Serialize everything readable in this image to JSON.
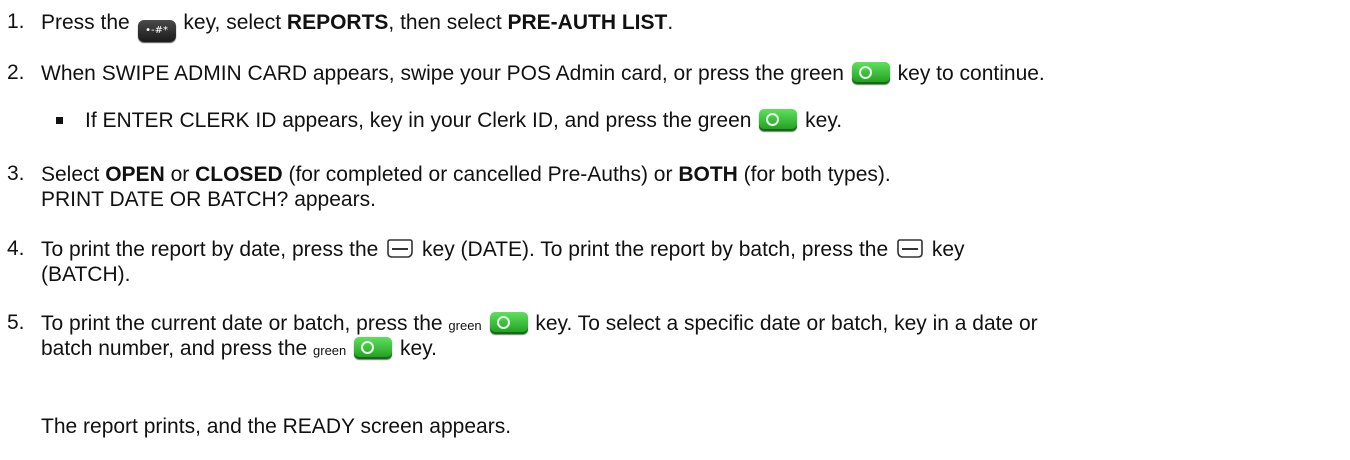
{
  "steps": [
    {
      "number": "1.",
      "parts": [
        "Press the",
        "key, select",
        "REPORTS",
        ", then select",
        "PRE-AUTH LIST",
        "."
      ],
      "icons": {
        "func_key": "function-key-icon"
      }
    },
    {
      "number": "2.",
      "parts": [
        "When SWIPE ADMIN CARD appears, swipe your POS Admin card, or press the green",
        "key to continue."
      ]
    },
    {
      "bullet": true,
      "parts": [
        "If ENTER CLERK ID appears, key in your Clerk ID, and press the green",
        "key."
      ]
    },
    {
      "number": "3.",
      "parts": [
        "Select",
        "OPEN",
        "or",
        "CLOSED",
        "(for completed or cancelled Pre-Auths) or",
        "BOTH",
        "(for both types)."
      ],
      "line2": "PRINT DATE OR BATCH? appears."
    },
    {
      "number": "4.",
      "parts": [
        "To print the report by date, press the",
        "key (DATE). To print the report by batch, press the",
        "key"
      ],
      "line2": "(BATCH)."
    },
    {
      "number": "5.",
      "parts": [
        "To print the current date or batch, press the",
        "green",
        "key. To select a specific date or batch, key in a date or"
      ],
      "line2_parts": [
        "batch number, and press the",
        "green",
        "key."
      ]
    }
  ],
  "final_text": "The report prints, and the READY screen appears.",
  "func_key_glyph": "•-#*",
  "colors": {
    "green_key": "#2fb52f",
    "text": "#111111"
  }
}
